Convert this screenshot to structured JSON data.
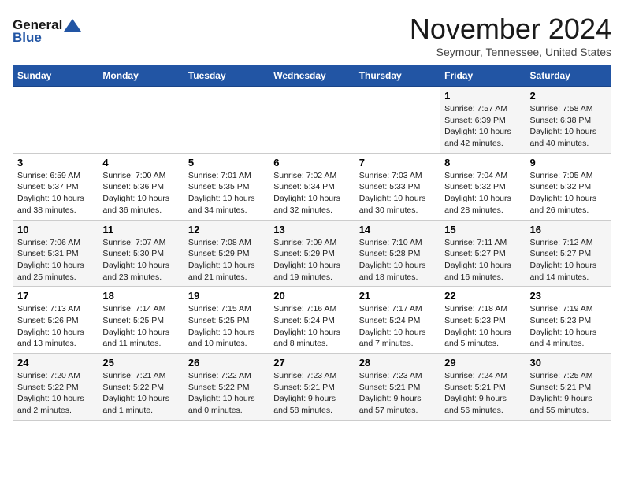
{
  "header": {
    "logo_line1": "General",
    "logo_line2": "Blue",
    "title": "November 2024",
    "subtitle": "Seymour, Tennessee, United States"
  },
  "days_of_week": [
    "Sunday",
    "Monday",
    "Tuesday",
    "Wednesday",
    "Thursday",
    "Friday",
    "Saturday"
  ],
  "weeks": [
    [
      {
        "day": "",
        "info": ""
      },
      {
        "day": "",
        "info": ""
      },
      {
        "day": "",
        "info": ""
      },
      {
        "day": "",
        "info": ""
      },
      {
        "day": "",
        "info": ""
      },
      {
        "day": "1",
        "info": "Sunrise: 7:57 AM\nSunset: 6:39 PM\nDaylight: 10 hours and 42 minutes."
      },
      {
        "day": "2",
        "info": "Sunrise: 7:58 AM\nSunset: 6:38 PM\nDaylight: 10 hours and 40 minutes."
      }
    ],
    [
      {
        "day": "3",
        "info": "Sunrise: 6:59 AM\nSunset: 5:37 PM\nDaylight: 10 hours and 38 minutes."
      },
      {
        "day": "4",
        "info": "Sunrise: 7:00 AM\nSunset: 5:36 PM\nDaylight: 10 hours and 36 minutes."
      },
      {
        "day": "5",
        "info": "Sunrise: 7:01 AM\nSunset: 5:35 PM\nDaylight: 10 hours and 34 minutes."
      },
      {
        "day": "6",
        "info": "Sunrise: 7:02 AM\nSunset: 5:34 PM\nDaylight: 10 hours and 32 minutes."
      },
      {
        "day": "7",
        "info": "Sunrise: 7:03 AM\nSunset: 5:33 PM\nDaylight: 10 hours and 30 minutes."
      },
      {
        "day": "8",
        "info": "Sunrise: 7:04 AM\nSunset: 5:32 PM\nDaylight: 10 hours and 28 minutes."
      },
      {
        "day": "9",
        "info": "Sunrise: 7:05 AM\nSunset: 5:32 PM\nDaylight: 10 hours and 26 minutes."
      }
    ],
    [
      {
        "day": "10",
        "info": "Sunrise: 7:06 AM\nSunset: 5:31 PM\nDaylight: 10 hours and 25 minutes."
      },
      {
        "day": "11",
        "info": "Sunrise: 7:07 AM\nSunset: 5:30 PM\nDaylight: 10 hours and 23 minutes."
      },
      {
        "day": "12",
        "info": "Sunrise: 7:08 AM\nSunset: 5:29 PM\nDaylight: 10 hours and 21 minutes."
      },
      {
        "day": "13",
        "info": "Sunrise: 7:09 AM\nSunset: 5:29 PM\nDaylight: 10 hours and 19 minutes."
      },
      {
        "day": "14",
        "info": "Sunrise: 7:10 AM\nSunset: 5:28 PM\nDaylight: 10 hours and 18 minutes."
      },
      {
        "day": "15",
        "info": "Sunrise: 7:11 AM\nSunset: 5:27 PM\nDaylight: 10 hours and 16 minutes."
      },
      {
        "day": "16",
        "info": "Sunrise: 7:12 AM\nSunset: 5:27 PM\nDaylight: 10 hours and 14 minutes."
      }
    ],
    [
      {
        "day": "17",
        "info": "Sunrise: 7:13 AM\nSunset: 5:26 PM\nDaylight: 10 hours and 13 minutes."
      },
      {
        "day": "18",
        "info": "Sunrise: 7:14 AM\nSunset: 5:25 PM\nDaylight: 10 hours and 11 minutes."
      },
      {
        "day": "19",
        "info": "Sunrise: 7:15 AM\nSunset: 5:25 PM\nDaylight: 10 hours and 10 minutes."
      },
      {
        "day": "20",
        "info": "Sunrise: 7:16 AM\nSunset: 5:24 PM\nDaylight: 10 hours and 8 minutes."
      },
      {
        "day": "21",
        "info": "Sunrise: 7:17 AM\nSunset: 5:24 PM\nDaylight: 10 hours and 7 minutes."
      },
      {
        "day": "22",
        "info": "Sunrise: 7:18 AM\nSunset: 5:23 PM\nDaylight: 10 hours and 5 minutes."
      },
      {
        "day": "23",
        "info": "Sunrise: 7:19 AM\nSunset: 5:23 PM\nDaylight: 10 hours and 4 minutes."
      }
    ],
    [
      {
        "day": "24",
        "info": "Sunrise: 7:20 AM\nSunset: 5:22 PM\nDaylight: 10 hours and 2 minutes."
      },
      {
        "day": "25",
        "info": "Sunrise: 7:21 AM\nSunset: 5:22 PM\nDaylight: 10 hours and 1 minute."
      },
      {
        "day": "26",
        "info": "Sunrise: 7:22 AM\nSunset: 5:22 PM\nDaylight: 10 hours and 0 minutes."
      },
      {
        "day": "27",
        "info": "Sunrise: 7:23 AM\nSunset: 5:21 PM\nDaylight: 9 hours and 58 minutes."
      },
      {
        "day": "28",
        "info": "Sunrise: 7:23 AM\nSunset: 5:21 PM\nDaylight: 9 hours and 57 minutes."
      },
      {
        "day": "29",
        "info": "Sunrise: 7:24 AM\nSunset: 5:21 PM\nDaylight: 9 hours and 56 minutes."
      },
      {
        "day": "30",
        "info": "Sunrise: 7:25 AM\nSunset: 5:21 PM\nDaylight: 9 hours and 55 minutes."
      }
    ]
  ]
}
